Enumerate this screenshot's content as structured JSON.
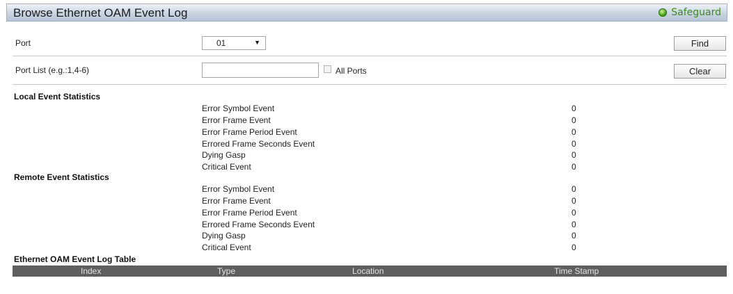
{
  "header": {
    "title": "Browse Ethernet OAM Event Log",
    "safeguard": "Safeguard"
  },
  "form": {
    "port_label": "Port",
    "port_value": "01",
    "port_list_label": "Port List (e.g.:1,4-6)",
    "port_list_value": "",
    "all_ports_label": "All Ports",
    "find_label": "Find",
    "clear_label": "Clear"
  },
  "local": {
    "title": "Local Event Statistics",
    "rows": [
      {
        "name": "Error Symbol Event",
        "value": "0"
      },
      {
        "name": "Error Frame Event",
        "value": "0"
      },
      {
        "name": "Error Frame Period Event",
        "value": "0"
      },
      {
        "name": "Errored Frame Seconds Event",
        "value": "0"
      },
      {
        "name": "Dying Gasp",
        "value": "0"
      },
      {
        "name": "Critical Event",
        "value": "0"
      }
    ]
  },
  "remote": {
    "title": "Remote Event Statistics",
    "rows": [
      {
        "name": "Error Symbol Event",
        "value": "0"
      },
      {
        "name": "Error Frame Event",
        "value": "0"
      },
      {
        "name": "Error Frame Period Event",
        "value": "0"
      },
      {
        "name": "Errored Frame Seconds Event",
        "value": "0"
      },
      {
        "name": "Dying Gasp",
        "value": "0"
      },
      {
        "name": "Critical Event",
        "value": "0"
      }
    ]
  },
  "log_table": {
    "title": "Ethernet OAM Event Log Table",
    "columns": [
      "Index",
      "Type",
      "Location",
      "Time Stamp"
    ]
  }
}
